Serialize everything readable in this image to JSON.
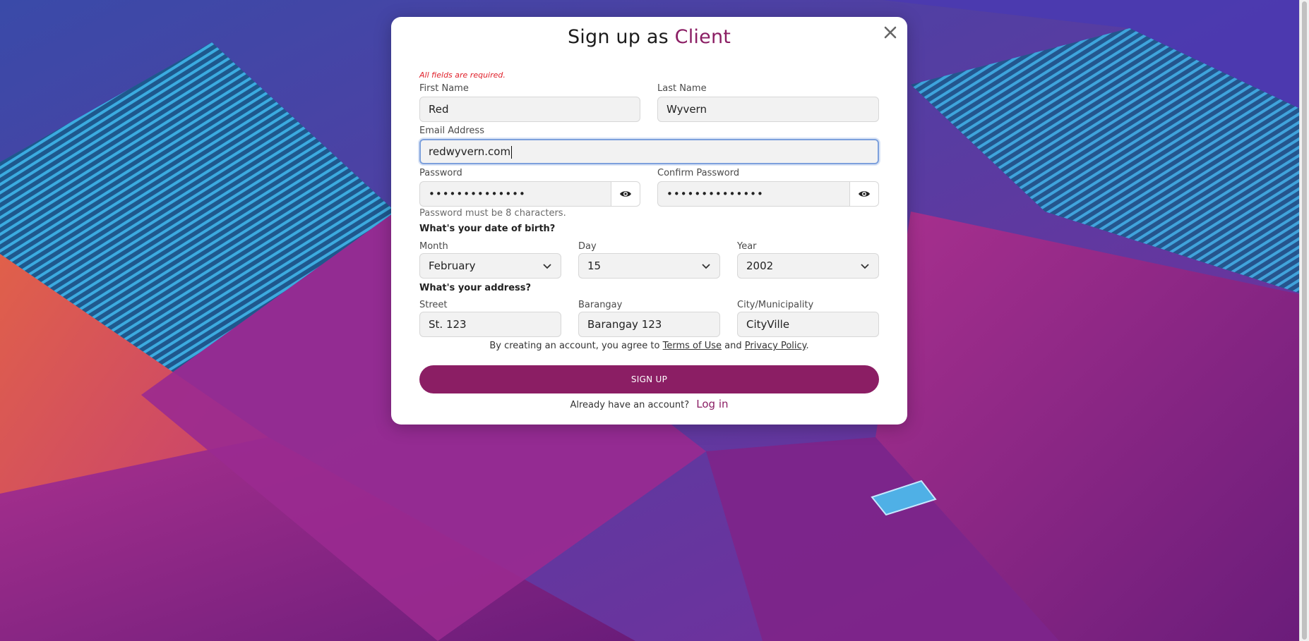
{
  "modal": {
    "title_prefix": "Sign up as",
    "title_accent": "Client",
    "required_note": "All fields are required."
  },
  "form": {
    "first_name": {
      "label": "First Name",
      "value": "Red"
    },
    "last_name": {
      "label": "Last Name",
      "value": "Wyvern"
    },
    "email": {
      "label": "Email Address",
      "value": "redwyvern.com"
    },
    "password": {
      "label": "Password",
      "value": "••••••••••••••"
    },
    "confirm_password": {
      "label": "Confirm Password",
      "value": "••••••••••••••"
    },
    "password_hint": "Password must be 8 characters.",
    "dob_heading": "What's your date of birth?",
    "month": {
      "label": "Month",
      "value": "February"
    },
    "day": {
      "label": "Day",
      "value": "15"
    },
    "year": {
      "label": "Year",
      "value": "2002"
    },
    "address_heading": "What's your address?",
    "street": {
      "label": "Street",
      "value": "St. 123"
    },
    "barangay": {
      "label": "Barangay",
      "value": "Barangay 123"
    },
    "city": {
      "label": "City/Municipality",
      "value": "CityVille"
    }
  },
  "terms": {
    "prefix": "By creating an account, you agree to",
    "terms_link": "Terms of Use",
    "and": "and",
    "privacy_link": "Privacy Policy",
    "suffix": "."
  },
  "actions": {
    "signup_label": "SIGN UP",
    "have_account": "Already have an account?",
    "login_label": "Log in"
  },
  "colors": {
    "accent": "#8b1e64",
    "error": "#e0202a",
    "focus_border": "#7da0dc"
  }
}
